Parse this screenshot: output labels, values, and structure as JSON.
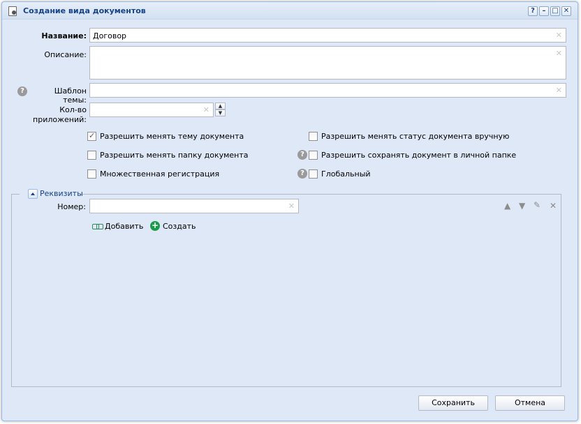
{
  "window": {
    "title": "Создание вида документов",
    "tools": [
      "?",
      "–",
      "□",
      "✕"
    ]
  },
  "form": {
    "name_label": "Название:",
    "name_value": "Договор",
    "description_label": "Описание:",
    "description_value": "",
    "subject_template_label": "Шаблон темы:",
    "subject_template_value": "",
    "attachments_label_1": "Кол-во",
    "attachments_label_2": "приложений:",
    "attachments_value": ""
  },
  "checkboxes": {
    "allow_change_subject": {
      "label": "Разрешить менять тему документа",
      "checked": true
    },
    "allow_change_status": {
      "label": "Разрешить менять статус документа вручную",
      "checked": false
    },
    "allow_change_folder": {
      "label": "Разрешить менять папку документа",
      "checked": false
    },
    "allow_save_personal": {
      "label": "Разрешить сохранять документ в личной папке",
      "checked": false
    },
    "multiple_registration": {
      "label": "Множественная регистрация",
      "checked": false
    },
    "global": {
      "label": "Глобальный",
      "checked": false
    }
  },
  "requisites": {
    "legend": "Реквизиты",
    "number_label": "Номер:",
    "number_value": "",
    "add_label": "Добавить",
    "create_label": "Создать"
  },
  "footer": {
    "save_label": "Сохранить",
    "cancel_label": "Отмена"
  }
}
